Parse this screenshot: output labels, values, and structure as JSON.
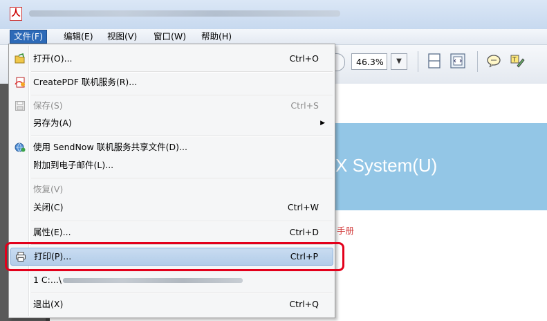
{
  "window": {
    "app_icon": "pdf-icon"
  },
  "menubar": {
    "items": [
      {
        "label": "文件(F)"
      },
      {
        "label": "编辑(E)"
      },
      {
        "label": "视图(V)"
      },
      {
        "label": "窗口(W)"
      },
      {
        "label": "帮助(H)"
      }
    ]
  },
  "toolbar": {
    "zoom": "46.3%",
    "icons": [
      "fit-page-icon",
      "fit-width-icon",
      "comment-icon",
      "highlight-icon"
    ]
  },
  "document": {
    "banner_text": "X System(U)",
    "red_text": "手册",
    "banner_color": "#93c6e6"
  },
  "file_menu": {
    "items": [
      {
        "label": "打开(O)...",
        "shortcut": "Ctrl+O",
        "icon": "open-folder-icon"
      },
      {
        "label": "CreatePDF 联机服务(R)...",
        "shortcut": "",
        "icon": "createpdf-icon"
      },
      {
        "label": "保存(S)",
        "shortcut": "Ctrl+S",
        "icon": "save-icon"
      },
      {
        "label": "另存为(A)",
        "shortcut": "",
        "icon": ""
      },
      {
        "label": "使用 SendNow 联机服务共享文件(D)...",
        "shortcut": "",
        "icon": "sendnow-icon"
      },
      {
        "label": "附加到电子邮件(L)...",
        "shortcut": "",
        "icon": ""
      },
      {
        "label": "恢复(V)",
        "shortcut": "",
        "icon": ""
      },
      {
        "label": "关闭(C)",
        "shortcut": "Ctrl+W",
        "icon": ""
      },
      {
        "label": "属性(E)...",
        "shortcut": "Ctrl+D",
        "icon": ""
      },
      {
        "label": "打印(P)...",
        "shortcut": "Ctrl+P",
        "icon": "printer-icon"
      },
      {
        "label": "1 C:...\\",
        "shortcut": "",
        "icon": ""
      },
      {
        "label": "退出(X)",
        "shortcut": "Ctrl+Q",
        "icon": ""
      }
    ]
  },
  "colors": {
    "highlight_frame": "#e3001b",
    "menu_active": "#2d6ab8"
  }
}
